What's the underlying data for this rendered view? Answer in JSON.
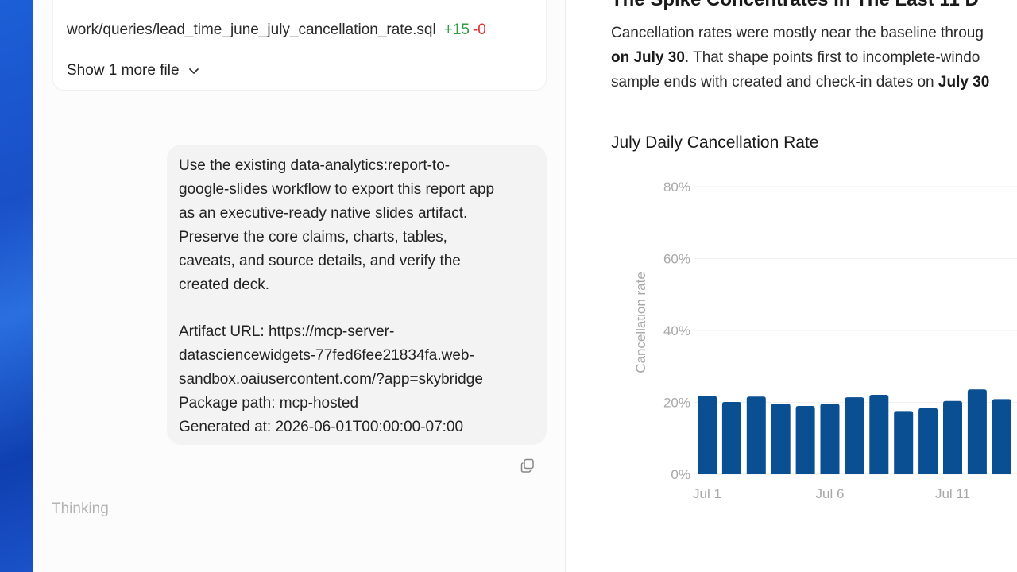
{
  "chat": {
    "files": {
      "file_path": "work/queries/lead_time_june_july_cancellation_rate.sql",
      "additions": "+15",
      "deletions": "-0",
      "show_more_label": "Show 1 more file"
    },
    "message": {
      "lines": [
        "Use the existing data-analytics:report-to-",
        "google-slides workflow to export this report app",
        "as an executive-ready native slides artifact.",
        "Preserve the core claims, charts, tables,",
        "caveats, and source details, and verify the",
        "created deck."
      ],
      "details": [
        "Artifact URL: https://mcp-server-",
        "datasciencewidgets-77fed6fee21834fa.web-",
        "sandbox.oaiusercontent.com/?app=skybridge",
        "Package path: mcp-hosted",
        "Generated at: 2026-06-01T00:00:00-07:00"
      ]
    },
    "status": "Thinking"
  },
  "report": {
    "section_title": "The Spike Concentrates In The Last 11 D",
    "line1": "Cancellation rates were mostly near the baseline throug",
    "line2_bold": "on July 30",
    "line2_rest": ". That shape points first to incomplete-windo",
    "line3_pre": "sample ends with created and check-in dates on ",
    "line3_bold": "July 30"
  },
  "chart_data": {
    "type": "bar",
    "title": "July Daily Cancellation Rate",
    "ylabel": "Cancellation rate",
    "ylim": [
      0,
      80
    ],
    "yticks": [
      "0%",
      "20%",
      "40%",
      "60%",
      "80%"
    ],
    "xtick_labels": [
      "Jul 1",
      "Jul 6",
      "Jul 11"
    ],
    "categories": [
      "Jul 1",
      "Jul 2",
      "Jul 3",
      "Jul 4",
      "Jul 5",
      "Jul 6",
      "Jul 7",
      "Jul 8",
      "Jul 9",
      "Jul 10",
      "Jul 11",
      "Jul 12",
      "Jul 13"
    ],
    "values": [
      21.8,
      20.1,
      21.6,
      19.6,
      19.0,
      19.6,
      21.4,
      22.1,
      17.6,
      18.4,
      20.4,
      23.6,
      20.9
    ],
    "bar_color": "#0a4f91"
  }
}
